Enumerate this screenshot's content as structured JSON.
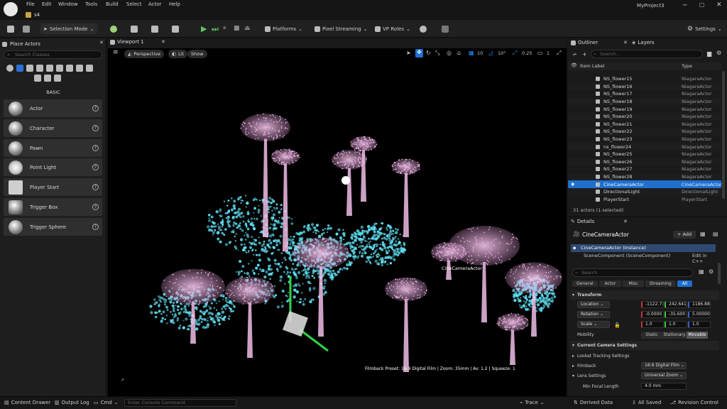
{
  "title_bar": {
    "menus": [
      "File",
      "Edit",
      "Window",
      "Tools",
      "Build",
      "Select",
      "Actor",
      "Help"
    ],
    "project": "MyProject3",
    "level_tab": "s4"
  },
  "toolbar": {
    "mode": "Selection Mode",
    "platforms": "Platforms",
    "pixel_streaming": "Pixel Streaming",
    "vp_roles": "VP Roles",
    "settings": "Settings"
  },
  "place_actors": {
    "tab": "Place Actors",
    "search_placeholder": "Search Classes",
    "category": "BASIC",
    "items": [
      "Actor",
      "Character",
      "Pawn",
      "Point Light",
      "Player Start",
      "Trigger Box",
      "Trigger Sphere"
    ]
  },
  "viewport": {
    "tab": "Viewport 1",
    "perspective": "Perspective",
    "lit": "Lit",
    "show": "Show",
    "grid_snap": "10",
    "rot_snap": "10°",
    "scale_snap": "0.25",
    "cam_speed": "1",
    "camera_label": "CineCameraActor",
    "film_info": "Filmback Preset: 16:9 Digital Film | Zoom: 35mm | Av: 1.2 | Squeeze: 1"
  },
  "outliner": {
    "tab": "Outliner",
    "layers_tab": "Layers",
    "search_placeholder": "Search...",
    "col_label": "Item Label",
    "col_type": "Type",
    "rows": [
      {
        "name": "NS_flower15",
        "type": "NiagaraActor"
      },
      {
        "name": "NS_flower16",
        "type": "NiagaraActor"
      },
      {
        "name": "NS_flower17",
        "type": "NiagaraActor"
      },
      {
        "name": "NS_flower18",
        "type": "NiagaraActor"
      },
      {
        "name": "NS_flower19",
        "type": "NiagaraActor"
      },
      {
        "name": "NS_flower20",
        "type": "NiagaraActor"
      },
      {
        "name": "NS_flower21",
        "type": "NiagaraActor"
      },
      {
        "name": "NS_flower22",
        "type": "NiagaraActor"
      },
      {
        "name": "NS_flower23",
        "type": "NiagaraActor"
      },
      {
        "name": "ns_flower24",
        "type": "NiagaraActor"
      },
      {
        "name": "NS_flower25",
        "type": "NiagaraActor"
      },
      {
        "name": "NS_flower26",
        "type": "NiagaraActor"
      },
      {
        "name": "NS_flower27",
        "type": "NiagaraActor"
      },
      {
        "name": "NS_flower28",
        "type": "NiagaraActor"
      },
      {
        "name": "CineCameraActor",
        "type": "CineCameraActor"
      },
      {
        "name": "DirectionalLight",
        "type": "DirectionalLight"
      },
      {
        "name": "PlayerStart",
        "type": "PlayerStart"
      }
    ],
    "status": "31 actors (1 selected)"
  },
  "details": {
    "tab": "Details",
    "actor_name": "CineCameraActor",
    "add": "+ Add",
    "instance": "CineCameraActor (Instance)",
    "component": "SceneComponent (SceneComponent)",
    "edit_cpp": "Edit in C++",
    "search_placeholder": "Search",
    "filters": [
      "General",
      "Actor",
      "Misc",
      "Streaming",
      "All"
    ],
    "transform": "Transform",
    "location": "Location",
    "rotation": "Rotation",
    "scale": "Scale",
    "loc_vals": [
      "-1122.71",
      "242.641",
      "1186.88"
    ],
    "rot_vals": [
      "-0.0000",
      "-35.600",
      "5.00000"
    ],
    "scale_vals": [
      "1.0",
      "1.0",
      "1.0"
    ],
    "mobility": "Mobility",
    "mobility_opts": [
      "Static",
      "Stationary",
      "Movable"
    ],
    "current_camera": "Current Camera Settings",
    "lookat": "Lookat Tracking Settings",
    "filmback": "Filmback",
    "filmback_val": "16:9 Digital Film",
    "lens": "Lens Settings",
    "lens_val": "Universal Zoom",
    "min_focal": "Min Focal Length",
    "min_focal_val": "4.0 mm"
  },
  "bottom_bar": {
    "content_drawer": "Content Drawer",
    "output_log": "Output Log",
    "cmd": "Cmd",
    "console_placeholder": "Enter Console Command",
    "trace": "Trace",
    "derived": "Derived Data",
    "saved": "All Saved",
    "revision": "Revision Control"
  },
  "colors": {
    "accent": "#1f6fcf",
    "pink": "#f3b6e8",
    "cyan": "#5fdcef"
  }
}
